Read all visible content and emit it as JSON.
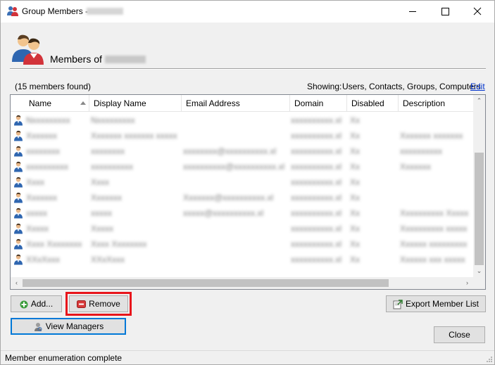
{
  "window": {
    "title": "Group Members - ",
    "title_redacted": "",
    "icons": {
      "app": "group-members-icon",
      "minimize": "minimize-icon",
      "maximize": "maximize-icon",
      "close": "close-icon"
    }
  },
  "header": {
    "title": "Members of ",
    "title_redacted": "",
    "icon": "users-group-icon"
  },
  "summary": {
    "found": "(15 members found)",
    "showing_label": "Showing:",
    "showing_value": "Users, Contacts, Groups, Computers",
    "edit_label": "Edit"
  },
  "table": {
    "columns": [
      "Name",
      "Display Name",
      "Email Address",
      "Domain",
      "Disabled",
      "Description"
    ],
    "sorted_column": "Name",
    "rows": [
      {
        "icon": "user-icon",
        "name": "Nxxxxxxxxx",
        "display": "Nxxxxxxxxx",
        "email": "",
        "domain": "xxxxxxxxxx.xl",
        "disabled": "Xx",
        "description": ""
      },
      {
        "icon": "user-icon",
        "name": "Xxxxxxx",
        "display": "Xxxxxxx xxxxxxx xxxxx",
        "email": "",
        "domain": "xxxxxxxxxx.xl",
        "disabled": "Xx",
        "description": "Xxxxxxx xxxxxxx"
      },
      {
        "icon": "user-icon",
        "name": "xxxxxxxx",
        "display": "xxxxxxxx",
        "email": "xxxxxxxx@xxxxxxxxxx.xl",
        "domain": "xxxxxxxxxx.xl",
        "disabled": "Xx",
        "description": "xxxxxxxxxx"
      },
      {
        "icon": "user-icon",
        "name": "xxxxxxxxxx",
        "display": "xxxxxxxxxx",
        "email": "xxxxxxxxxx@xxxxxxxxxx.xl",
        "domain": "xxxxxxxxxx.xl",
        "disabled": "Xx",
        "description": "Xxxxxxx"
      },
      {
        "icon": "user-icon",
        "name": "Xxxx",
        "display": "Xxxx",
        "email": "",
        "domain": "xxxxxxxxxx.xl",
        "disabled": "Xx",
        "description": ""
      },
      {
        "icon": "user-icon",
        "name": "Xxxxxxx",
        "display": "Xxxxxxx",
        "email": "Xxxxxxx@xxxxxxxxxx.xl",
        "domain": "xxxxxxxxxx.xl",
        "disabled": "Xx",
        "description": ""
      },
      {
        "icon": "user-icon",
        "name": "xxxxx",
        "display": "xxxxx",
        "email": "xxxxx@xxxxxxxxxx.xl",
        "domain": "xxxxxxxxxx.xl",
        "disabled": "Xx",
        "description": "Xxxxxxxxxx Xxxxx"
      },
      {
        "icon": "user-icon",
        "name": "Xxxxx",
        "display": "Xxxxx",
        "email": "",
        "domain": "xxxxxxxxxx.xl",
        "disabled": "Xx",
        "description": "Xxxxxxxxxx xxxxx"
      },
      {
        "icon": "user-icon",
        "name": "Xxxx Xxxxxxxx",
        "display": "Xxxx Xxxxxxxx",
        "email": "",
        "domain": "xxxxxxxxxx.xl",
        "disabled": "Xx",
        "description": "Xxxxxx xxxxxxxxx"
      },
      {
        "icon": "user-icon",
        "name": "XXxXxxx",
        "display": "XXxXxxx",
        "email": "",
        "domain": "xxxxxxxxxx.xl",
        "disabled": "Xx",
        "description": "Xxxxxx xxx xxxxx"
      }
    ]
  },
  "buttons": {
    "add": "Add...",
    "remove": "Remove",
    "export": "Export Member List",
    "view_managers": "View Managers",
    "close": "Close"
  },
  "status": "Member enumeration complete",
  "colors": {
    "highlight": "#e8151b",
    "link": "#0033cc",
    "focus": "#0078d7"
  }
}
